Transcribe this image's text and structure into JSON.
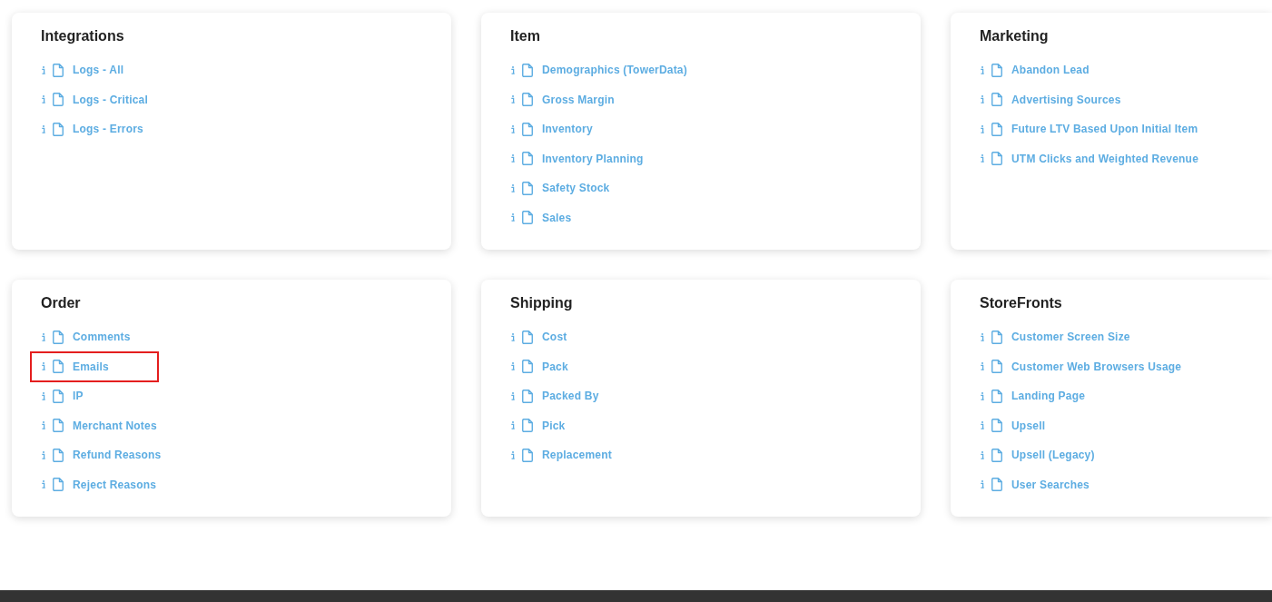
{
  "sections": [
    {
      "title": "Integrations",
      "items": [
        {
          "label": "Logs - All",
          "highlighted": false
        },
        {
          "label": "Logs - Critical",
          "highlighted": false
        },
        {
          "label": "Logs - Errors",
          "highlighted": false
        }
      ]
    },
    {
      "title": "Item",
      "items": [
        {
          "label": "Demographics (TowerData)",
          "highlighted": false
        },
        {
          "label": "Gross Margin",
          "highlighted": false
        },
        {
          "label": "Inventory",
          "highlighted": false
        },
        {
          "label": "Inventory Planning",
          "highlighted": false
        },
        {
          "label": "Safety Stock",
          "highlighted": false
        },
        {
          "label": "Sales",
          "highlighted": false
        }
      ]
    },
    {
      "title": "Marketing",
      "items": [
        {
          "label": "Abandon Lead",
          "highlighted": false
        },
        {
          "label": "Advertising Sources",
          "highlighted": false
        },
        {
          "label": "Future LTV Based Upon Initial Item",
          "highlighted": false
        },
        {
          "label": "UTM Clicks and Weighted Revenue",
          "highlighted": false
        }
      ]
    },
    {
      "title": "Order",
      "items": [
        {
          "label": "Comments",
          "highlighted": false
        },
        {
          "label": "Emails",
          "highlighted": true
        },
        {
          "label": "IP",
          "highlighted": false
        },
        {
          "label": "Merchant Notes",
          "highlighted": false
        },
        {
          "label": "Refund Reasons",
          "highlighted": false
        },
        {
          "label": "Reject Reasons",
          "highlighted": false
        }
      ]
    },
    {
      "title": "Shipping",
      "items": [
        {
          "label": "Cost",
          "highlighted": false
        },
        {
          "label": "Pack",
          "highlighted": false
        },
        {
          "label": "Packed By",
          "highlighted": false
        },
        {
          "label": "Pick",
          "highlighted": false
        },
        {
          "label": "Replacement",
          "highlighted": false
        }
      ]
    },
    {
      "title": "StoreFronts",
      "items": [
        {
          "label": "Customer Screen Size",
          "highlighted": false
        },
        {
          "label": "Customer Web Browsers Usage",
          "highlighted": false
        },
        {
          "label": "Landing Page",
          "highlighted": false
        },
        {
          "label": "Upsell",
          "highlighted": false
        },
        {
          "label": "Upsell (Legacy)",
          "highlighted": false
        },
        {
          "label": "User Searches",
          "highlighted": false
        }
      ]
    }
  ]
}
